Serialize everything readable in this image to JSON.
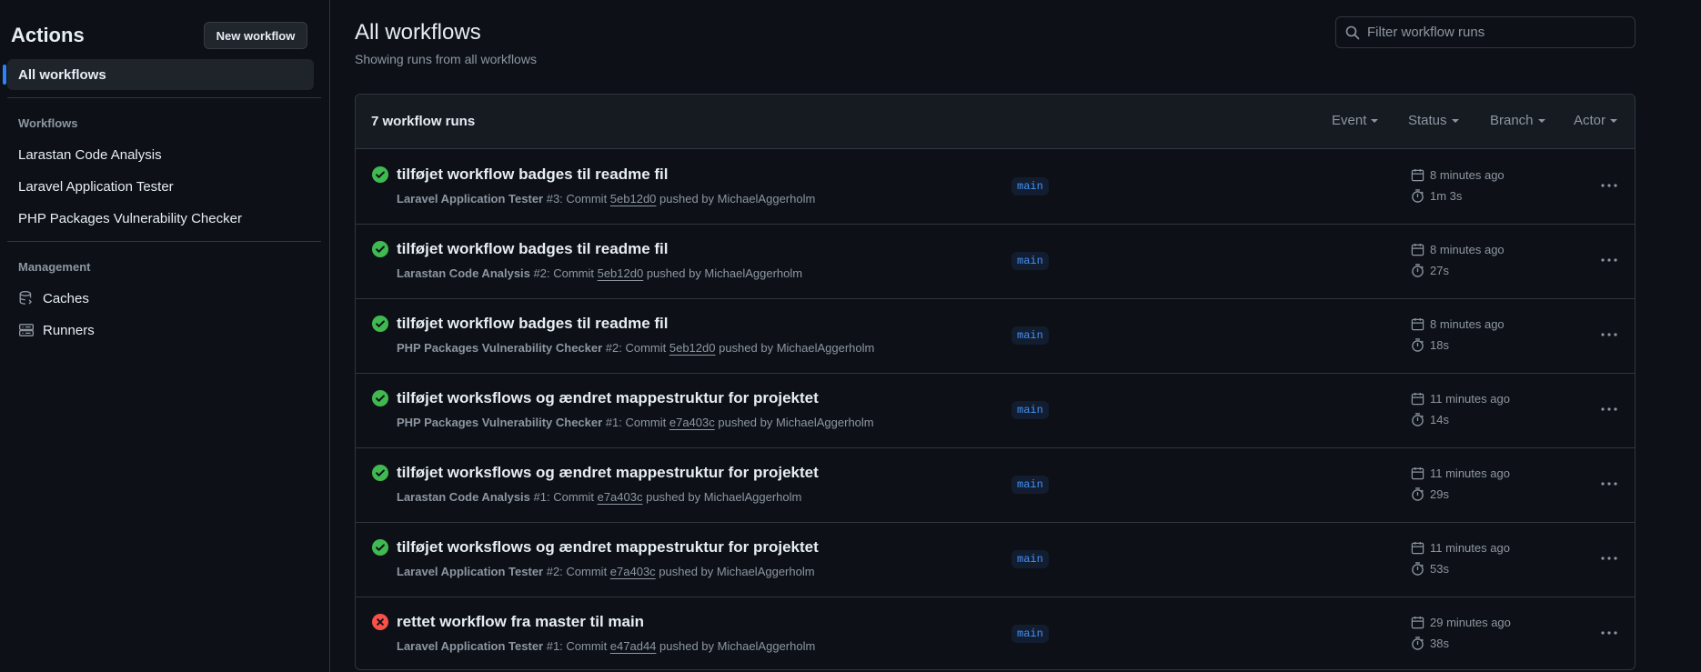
{
  "sidebar": {
    "title": "Actions",
    "new_workflow_label": "New workflow",
    "all_workflows_label": "All workflows",
    "workflows_section": "Workflows",
    "workflows": [
      {
        "label": "Larastan Code Analysis"
      },
      {
        "label": "Laravel Application Tester"
      },
      {
        "label": "PHP Packages Vulnerability Checker"
      }
    ],
    "management_section": "Management",
    "management": [
      {
        "label": "Caches",
        "icon": "database-icon"
      },
      {
        "label": "Runners",
        "icon": "server-icon"
      }
    ]
  },
  "main": {
    "title": "All workflows",
    "subtitle": "Showing runs from all workflows",
    "filter_placeholder": "Filter workflow runs",
    "runs_count": "7 workflow runs",
    "filters": [
      "Event",
      "Status",
      "Branch",
      "Actor"
    ],
    "colors": {
      "success": "#3fb950",
      "failure": "#f85149",
      "branch_text": "#4493f8"
    },
    "runs": [
      {
        "status": "success",
        "title": "tilføjet workflow badges til readme fil",
        "workflow": "Laravel Application Tester",
        "run_no": " #3: Commit ",
        "sha": "5eb12d0",
        "pushed_by": " pushed by MichaelAggerholm",
        "branch": "main",
        "when": "8 minutes ago",
        "duration": "1m 3s"
      },
      {
        "status": "success",
        "title": "tilføjet workflow badges til readme fil",
        "workflow": "Larastan Code Analysis",
        "run_no": " #2: Commit ",
        "sha": "5eb12d0",
        "pushed_by": " pushed by MichaelAggerholm",
        "branch": "main",
        "when": "8 minutes ago",
        "duration": "27s"
      },
      {
        "status": "success",
        "title": "tilføjet workflow badges til readme fil",
        "workflow": "PHP Packages Vulnerability Checker",
        "run_no": " #2: Commit ",
        "sha": "5eb12d0",
        "pushed_by": " pushed by MichaelAggerholm",
        "branch": "main",
        "when": "8 minutes ago",
        "duration": "18s"
      },
      {
        "status": "success",
        "title": "tilføjet worksflows og ændret mappestruktur for projektet",
        "workflow": "PHP Packages Vulnerability Checker",
        "run_no": " #1: Commit ",
        "sha": "e7a403c",
        "pushed_by": " pushed by MichaelAggerholm",
        "branch": "main",
        "when": "11 minutes ago",
        "duration": "14s"
      },
      {
        "status": "success",
        "title": "tilføjet worksflows og ændret mappestruktur for projektet",
        "workflow": "Larastan Code Analysis",
        "run_no": " #1: Commit ",
        "sha": "e7a403c",
        "pushed_by": " pushed by MichaelAggerholm",
        "branch": "main",
        "when": "11 minutes ago",
        "duration": "29s"
      },
      {
        "status": "success",
        "title": "tilføjet worksflows og ændret mappestruktur for projektet",
        "workflow": "Laravel Application Tester",
        "run_no": " #2: Commit ",
        "sha": "e7a403c",
        "pushed_by": " pushed by MichaelAggerholm",
        "branch": "main",
        "when": "11 minutes ago",
        "duration": "53s"
      },
      {
        "status": "failure",
        "title": "rettet workflow fra master til main",
        "workflow": "Laravel Application Tester",
        "run_no": " #1: Commit ",
        "sha": "e47ad44",
        "pushed_by": " pushed by MichaelAggerholm",
        "branch": "main",
        "when": "29 minutes ago",
        "duration": "38s"
      }
    ]
  }
}
